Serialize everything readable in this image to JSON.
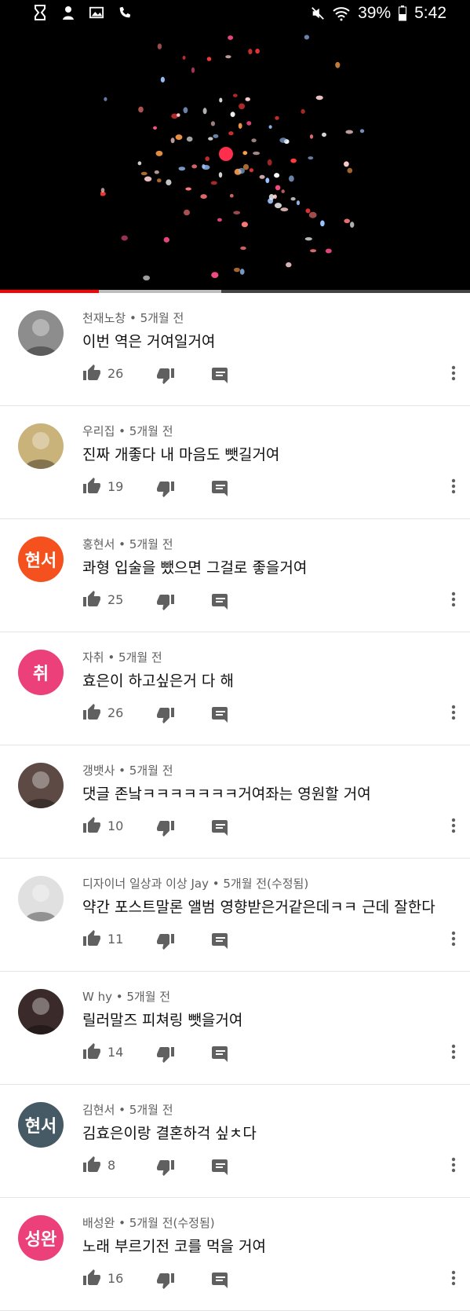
{
  "status_bar": {
    "battery": "39%",
    "time": "5:42"
  },
  "video": {
    "progress_played": 0.21,
    "progress_buffered": 0.47,
    "colors": {
      "played": "#ff0000",
      "buffered": "#bdbdbd",
      "track": "#444444"
    }
  },
  "comments": [
    {
      "author": "천재노창",
      "age": "5개월 전",
      "text": "이번 역은 거여일거여",
      "likes": "26",
      "avatar": {
        "type": "photo",
        "bg": "#8d8d8d"
      }
    },
    {
      "author": "우리집",
      "age": "5개월 전",
      "text": "진짜 개좋다 내 마음도 뺏길거여",
      "likes": "19",
      "avatar": {
        "type": "photo",
        "bg": "#c9b37a"
      }
    },
    {
      "author": "홍현서",
      "age": "5개월 전",
      "text": "콰형 입술을 뺐으면 그걸로 좋을거여",
      "likes": "25",
      "avatar": {
        "type": "initials",
        "initials": "현서",
        "bg": "#f4511e"
      }
    },
    {
      "author": "자취",
      "age": "5개월 전",
      "text": "효은이 하고싶은거 다 해",
      "likes": "26",
      "avatar": {
        "type": "initials",
        "initials": "취",
        "bg": "#ec407a"
      }
    },
    {
      "author": "갱뱃사",
      "age": "5개월 전",
      "text": "댓글 존낰ㅋㅋㅋㅋㅋㅋㅋ거여좌는 영원할 거여",
      "likes": "10",
      "avatar": {
        "type": "photo",
        "bg": "#5d4a44"
      }
    },
    {
      "author": "디자이너 일상과 이상 Jay",
      "age": "5개월 전(수정됨)",
      "text": "약간 포스트말론 앨범 영향받은거같은데ㅋㅋ 근데 잘한다",
      "likes": "11",
      "avatar": {
        "type": "photo",
        "bg": "#e0e0e0"
      }
    },
    {
      "author": "W hy",
      "age": "5개월 전",
      "text": "릴러말즈 피쳐링 뺏을거여",
      "likes": "14",
      "avatar": {
        "type": "photo",
        "bg": "#3a2a2a"
      }
    },
    {
      "author": "김현서",
      "age": "5개월 전",
      "text": "김효은이랑 결혼하걱 싶ㅊ다",
      "likes": "8",
      "avatar": {
        "type": "initials",
        "initials": "현서",
        "bg": "#455a64"
      }
    },
    {
      "author": "배성완",
      "age": "5개월 전(수정됨)",
      "text": "노래 부르기전 코를 먹을 거여",
      "likes": "16",
      "avatar": {
        "type": "initials",
        "initials": "성완",
        "bg": "#ec407a"
      }
    }
  ]
}
